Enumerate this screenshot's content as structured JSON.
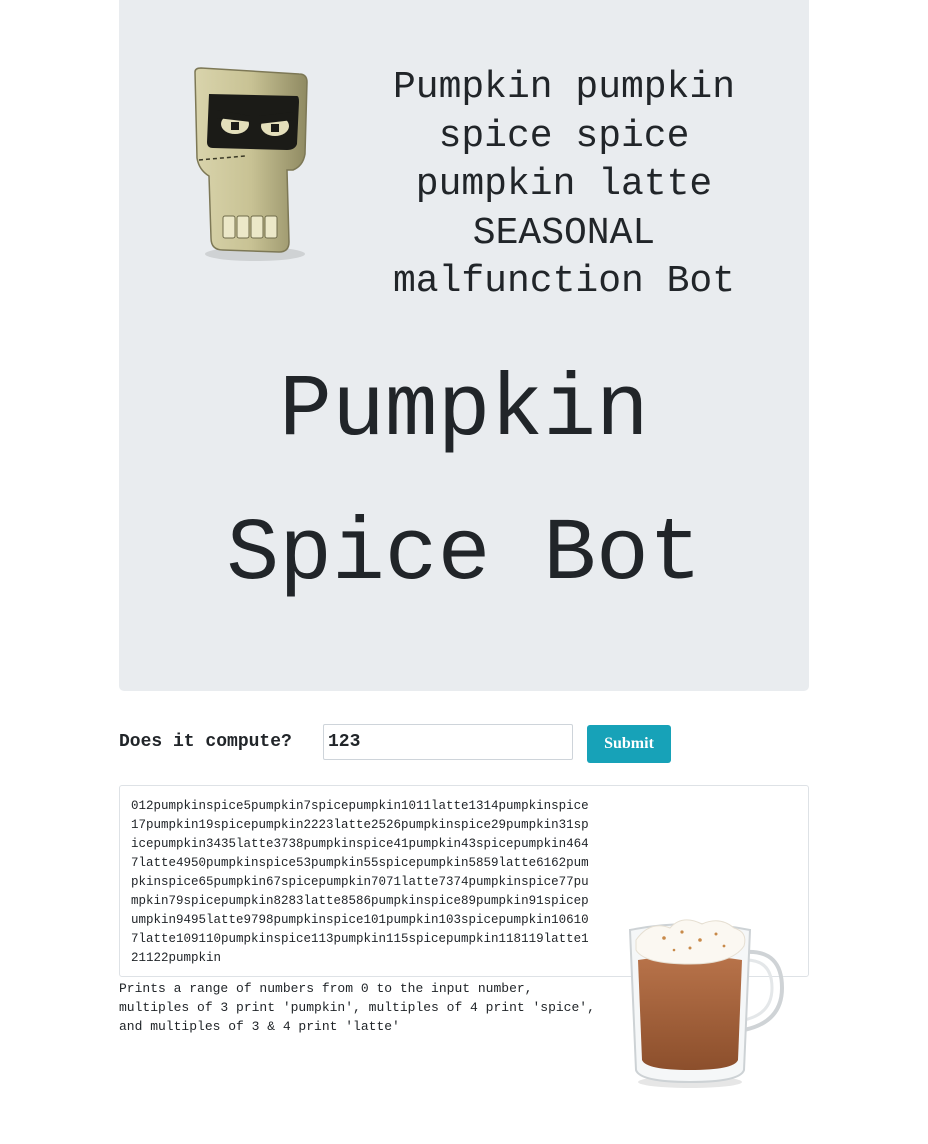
{
  "hero": {
    "tagline_lines": [
      "Pumpkin pumpkin",
      "spice spice",
      "pumpkin latte",
      "SEASONAL",
      "malfunction Bot"
    ],
    "title_lines": [
      "Pumpkin",
      "Spice Bot"
    ],
    "robot_icon": "robot-mascot-icon"
  },
  "form": {
    "label": "Does it compute?",
    "input_value": "123",
    "submit_label": "Submit"
  },
  "output": {
    "text": "012pumpkinspice5pumpkin7spicepumpkin1011latte1314pumpkinspice17pumpkin19spicepumpkin2223latte2526pumpkinspice29pumpkin31spicepumpkin3435latte3738pumpkinspice41pumpkin43spicepumpkin4647latte4950pumpkinspice53pumpkin55spicepumpkin5859latte6162pumpkinspice65pumpkin67spicepumpkin7071latte7374pumpkinspice77pumpkin79spicepumpkin8283latte8586pumpkinspice89pumpkin91spicepumpkin9495latte9798pumpkinspice101pumpkin103spicepumpkin106107latte109110pumpkinspice113pumpkin115spicepumpkin118119latte121122pumpkin"
  },
  "description": {
    "lines": [
      "Prints a range of numbers from 0 to the input number,",
      "multiples of 3 print 'pumpkin', multiples of 4 print 'spice',",
      "and multiples of 3 & 4 print 'latte'"
    ]
  },
  "decor": {
    "mug_icon": "pumpkin-latte-mug-icon"
  },
  "colors": {
    "hero_bg": "#e9ecef",
    "button_bg": "#17a2b8",
    "text": "#212529"
  }
}
